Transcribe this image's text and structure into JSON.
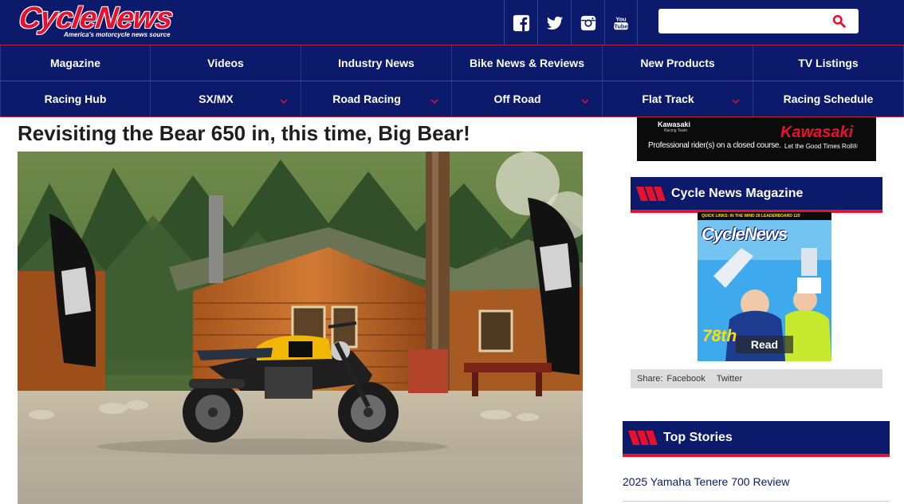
{
  "header": {
    "logo_text": "CycleNews",
    "logo_tagline": "America's motorcycle news source",
    "social": [
      "facebook-icon",
      "twitter-icon",
      "instagram-icon",
      "youtube-icon"
    ],
    "youtube_label_top": "You",
    "youtube_label_bottom": "Tube",
    "search": {
      "value": "",
      "placeholder": ""
    }
  },
  "nav": {
    "row1": [
      {
        "label": "Magazine"
      },
      {
        "label": "Videos"
      },
      {
        "label": "Industry News"
      },
      {
        "label": "Bike News & Reviews"
      },
      {
        "label": "New Products"
      },
      {
        "label": "TV Listings"
      }
    ],
    "row2": [
      {
        "label": "Racing Hub",
        "dropdown": false
      },
      {
        "label": "SX/MX",
        "dropdown": true
      },
      {
        "label": "Road Racing",
        "dropdown": true
      },
      {
        "label": "Off Road",
        "dropdown": true
      },
      {
        "label": "Flat Track",
        "dropdown": true
      },
      {
        "label": "Racing Schedule",
        "dropdown": false
      }
    ]
  },
  "article": {
    "headline": "Revisiting the Bear 650 in, this time, Big Bear!"
  },
  "sidebar": {
    "ad": {
      "brand_small": "Kawasaki",
      "brand_sub": "Racing Team",
      "disclaimer": "Professional rider(s) on a closed course.",
      "brand_large": "Kawasaki",
      "slogan": "Let the Good Times Roll®"
    },
    "magazine": {
      "title": "Cycle News Magazine",
      "cover_quicklinks": "QUICK LINKS: IN THE WIND 28 LEADERBOARD 120",
      "cover_logo": "CycleNews",
      "cover_number": "78th",
      "read_label": "Read",
      "share_label": "Share:",
      "share_facebook": "Facebook",
      "share_twitter": "Twitter"
    },
    "top_stories": {
      "title": "Top Stories",
      "items": [
        "2025 Yamaha Tenere 700 Review"
      ]
    }
  },
  "colors": {
    "navy": "#0c1a6b",
    "accent_red": "#e8112d",
    "divider_red": "#b8203d"
  }
}
